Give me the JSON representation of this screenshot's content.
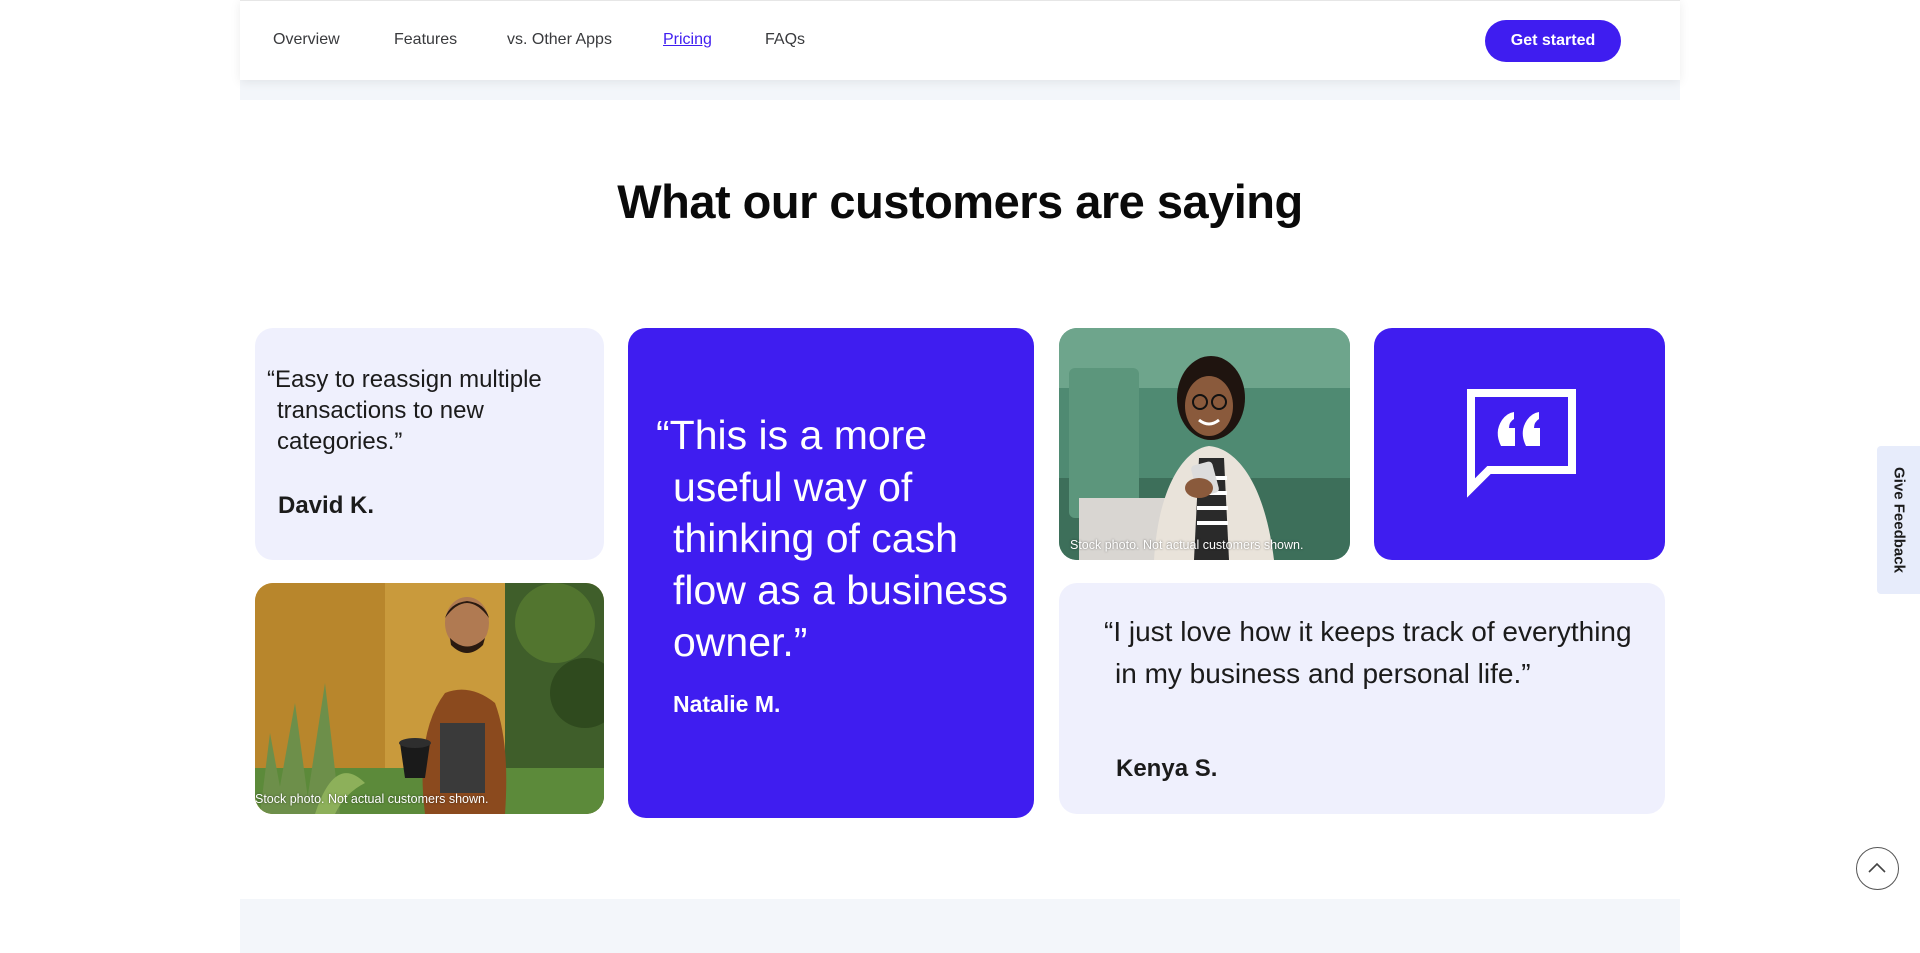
{
  "nav": {
    "links": [
      "Overview",
      "Features",
      "vs. Other Apps",
      "Pricing",
      "FAQs"
    ],
    "active": "Pricing",
    "cta_label": "Get started"
  },
  "section": {
    "heading": "What our customers are saying"
  },
  "testimonials": [
    {
      "quote": "“Easy to reassign multiple transactions to new categories.”",
      "author": "David K."
    },
    {
      "quote": "“This is a more useful way of thinking of cash flow as a business owner.”",
      "author": "Natalie M."
    },
    {
      "quote": "“I just love how it keeps track of everything in my business and personal life.”",
      "author": "Kenya S."
    }
  ],
  "photos": [
    {
      "caption": "Stock photo. Not actual customers shown.",
      "icon": "woman-smartphone-photo"
    },
    {
      "caption": "Stock photo. Not actual customers shown.",
      "icon": "man-gardening-photo"
    }
  ],
  "quote_badge_icon": "quote-bubble-icon",
  "feedback_label": "Give Feedback",
  "scroll_top_icon": "chevron-up-icon",
  "colors": {
    "brand": "#3f1df0",
    "card_lavender": "#eff0fd",
    "band": "#f3f6fa"
  }
}
